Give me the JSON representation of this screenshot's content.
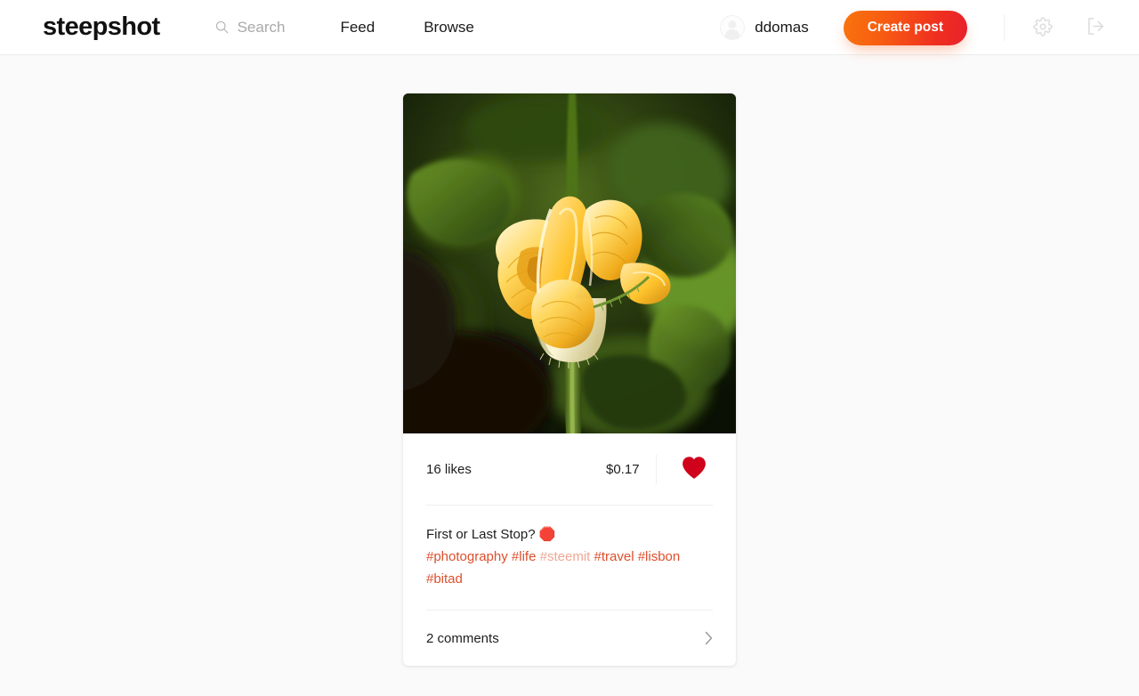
{
  "header": {
    "brand": "steepshot",
    "search": {
      "placeholder": "Search",
      "value": "",
      "icon": "search-icon"
    },
    "nav": [
      {
        "label": "Feed"
      },
      {
        "label": "Browse"
      }
    ],
    "user": {
      "name": "ddomas",
      "avatar_icon": "default-avatar-icon"
    },
    "create_post_label": "Create post",
    "settings_icon": "gear-icon",
    "logout_icon": "logout-icon",
    "colors": {
      "cta_gradient_start": "#f9740d",
      "cta_gradient_end": "#e8202c",
      "icon_gray": "#dcdcdc"
    }
  },
  "post": {
    "photo": {
      "alt": "yellow squash blossom in green foliage",
      "icon": "photo"
    },
    "likes_label": "16 likes",
    "payout": "$0.17",
    "like_icon": "heart-filled-icon",
    "like_color": "#d0021b",
    "liked": true,
    "caption": "First or Last Stop? ",
    "caption_emoji": "🛑",
    "tags": [
      {
        "label": "#photography",
        "faded": false
      },
      {
        "label": "#life",
        "faded": false
      },
      {
        "label": "#steemit",
        "faded": true
      },
      {
        "label": "#travel",
        "faded": false
      },
      {
        "label": "#lisbon",
        "faded": false
      },
      {
        "label": "#bitad",
        "faded": false
      }
    ],
    "tag_color": "#de4f2c",
    "tag_faded_color": "#f0a794",
    "comments_label": "2 comments",
    "comments_chevron_icon": "chevron-right-icon"
  }
}
